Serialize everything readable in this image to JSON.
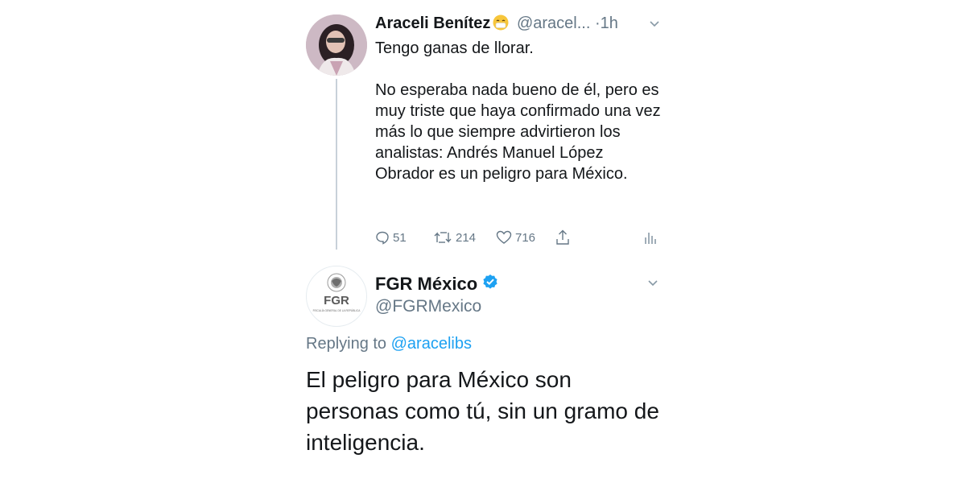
{
  "tweet1": {
    "name": "Araceli Benítez",
    "handle": "@aracel...",
    "separator": "·",
    "time": "1h",
    "body_lines": [
      "Tengo ganas de llorar.",
      "No esperaba nada bueno de él, pero es muy triste que haya confirmado una vez más lo que siempre advirtieron los analistas: Andrés Manuel López Obrador es un peligro para México."
    ],
    "reply_count": "51",
    "retweet_count": "214",
    "like_count": "716",
    "icons": {
      "reply": "reply-icon",
      "retweet": "retweet-icon",
      "like": "heart-icon",
      "share": "share-icon",
      "analytics": "analytics-icon",
      "menu": "chevron-down-icon",
      "emoji": "face-with-medical-mask-icon"
    }
  },
  "tweet2": {
    "name": "FGR México",
    "handle": "@FGRMexico",
    "verified": true,
    "avatar_text": "FGR",
    "avatar_subtext": "FISCALÍA GENERAL DE LA REPÚBLICA",
    "replying_prefix": "Replying to",
    "replying_to": "@aracelibs",
    "body": "El peligro para México son personas como tú, sin un gramo de inteligencia."
  },
  "colors": {
    "text": "#14171a",
    "secondary": "#657786",
    "link": "#1da1f2",
    "verified": "#1da1f2",
    "thread_line": "#c8d1d9"
  }
}
